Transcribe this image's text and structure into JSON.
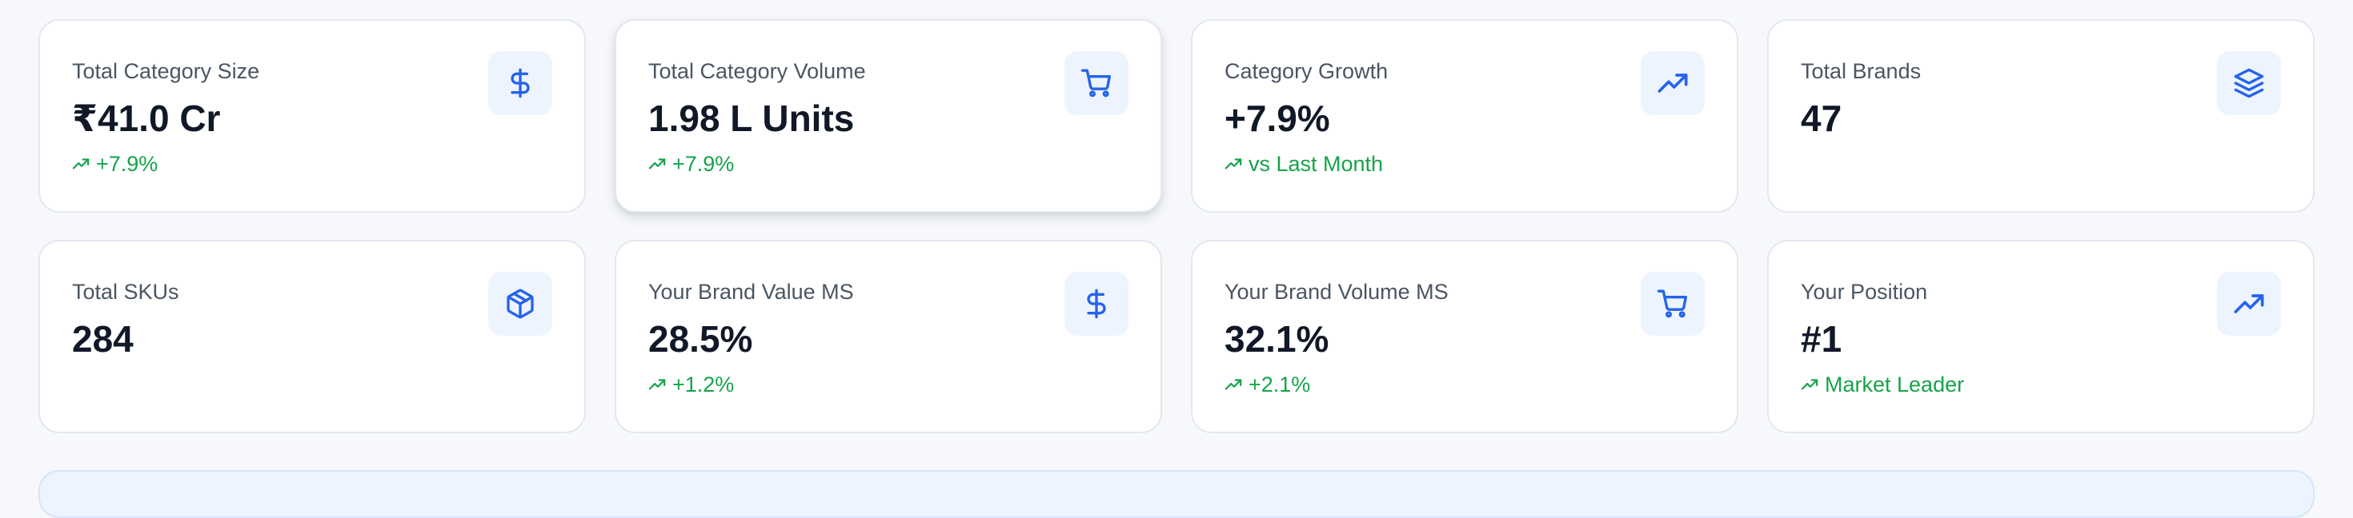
{
  "kpi_cards": [
    {
      "label": "Total Category Size",
      "value": "₹41.0 Cr",
      "trend": "+7.9%",
      "icon": "dollar-icon"
    },
    {
      "label": "Total Category Volume",
      "value": "1.98 L Units",
      "trend": "+7.9%",
      "icon": "shopping-cart-icon"
    },
    {
      "label": "Category Growth",
      "value": "+7.9%",
      "trend": "vs Last Month",
      "icon": "trending-up-icon"
    },
    {
      "label": "Total Brands",
      "value": "47",
      "trend": "",
      "icon": "layers-icon"
    },
    {
      "label": "Total SKUs",
      "value": "284",
      "trend": "",
      "icon": "package-icon"
    },
    {
      "label": "Your Brand Value MS",
      "value": "28.5%",
      "trend": "+1.2%",
      "icon": "dollar-icon"
    },
    {
      "label": "Your Brand Volume MS",
      "value": "32.1%",
      "trend": "+2.1%",
      "icon": "shopping-cart-icon"
    },
    {
      "label": "Your Position",
      "value": "#1",
      "trend": "Market Leader",
      "icon": "trending-up-icon"
    }
  ],
  "colors": {
    "accent": "#2563eb",
    "icon_background": "#edf4fe",
    "positive": "#16a34a",
    "text_primary": "#111827",
    "text_secondary": "#4b5563",
    "card_border": "#e3e7ee",
    "page_background": "#f6f8fb"
  }
}
